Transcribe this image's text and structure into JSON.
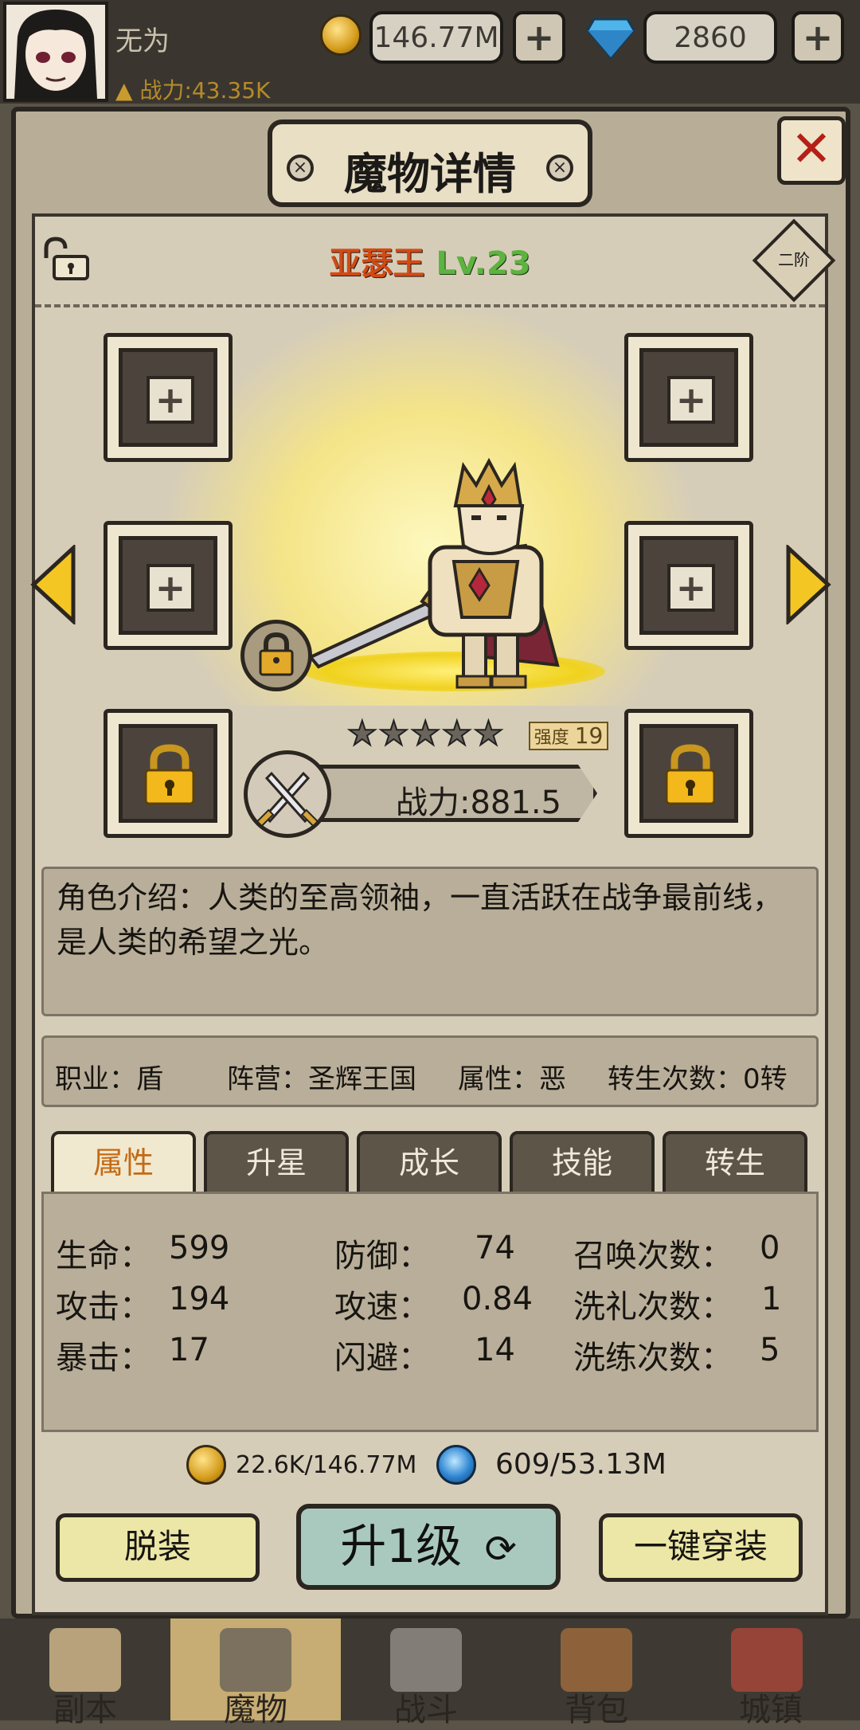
{
  "topbar": {
    "player_name": "无为",
    "power": "战力:43.35K",
    "gold": "146.77M",
    "gems": "2860"
  },
  "dialog": {
    "title": "魔物详情",
    "monster_name": "亚瑟王",
    "monster_level": "Lv.23",
    "rank": "二阶",
    "strength_label": "强度",
    "strength_value": "19",
    "stars": 5,
    "power": "战力:881.5",
    "description": "角色介绍：人类的至高领袖，一直活跃在战争最前线，是人类的希望之光。"
  },
  "info": {
    "job": "职业：盾",
    "faction": "阵营：圣辉王国",
    "attribute": "属性：恶",
    "rebirth": "转生次数：0转"
  },
  "tabs": [
    "属性",
    "升星",
    "成长",
    "技能",
    "转生"
  ],
  "stats": {
    "hp_label": "生命：",
    "hp": "599",
    "atk_label": "攻击：",
    "atk": "194",
    "crit_label": "暴击：",
    "crit": "17",
    "def_label": "防御：",
    "def": "74",
    "spd_label": "攻速：",
    "spd": "0.84",
    "dodge_label": "闪避：",
    "dodge": "14",
    "summon_label": "召唤次数：",
    "summon": "0",
    "baptism_label": "洗礼次数：",
    "baptism": "1",
    "refine_label": "洗练次数：",
    "refine": "5"
  },
  "costs": {
    "gold": "22.6K/146.77M",
    "essence": "609/53.13M"
  },
  "buttons": {
    "unequip": "脱装",
    "upgrade": "升1级",
    "equip_all": "一键穿装"
  },
  "nav": [
    "副本",
    "魔物",
    "战斗",
    "背包",
    "城镇"
  ],
  "colors": {
    "accent_orange": "#d24a14",
    "level_green": "#5db33f",
    "active_tab_text": "#c46a16",
    "close_red": "#b51f18"
  }
}
